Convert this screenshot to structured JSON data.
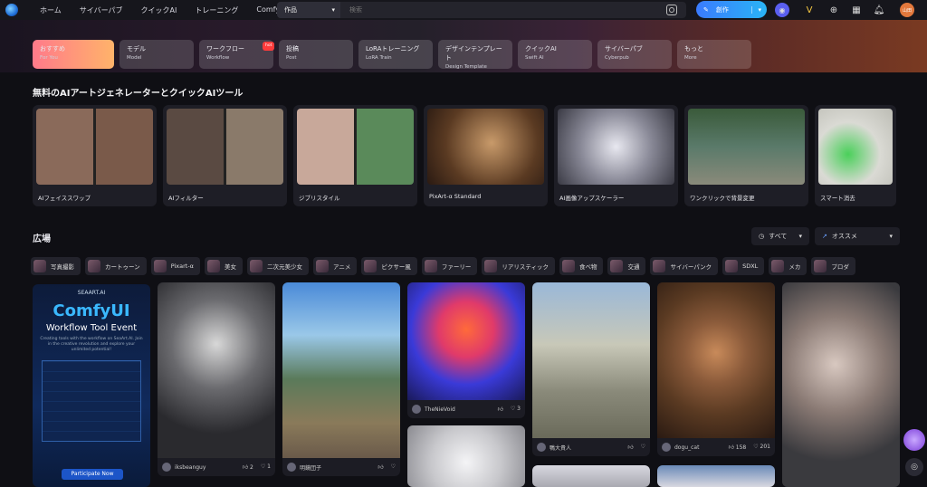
{
  "nav": {
    "items": [
      "ホーム",
      "サイバーパブ",
      "クイックAI",
      "トレーニング",
      "ComfyUI"
    ]
  },
  "search": {
    "scope": "作品",
    "placeholder": "検索"
  },
  "create": {
    "label": "創作"
  },
  "user": {
    "avatar_text": "山田"
  },
  "categories": [
    {
      "ja": "おすすめ",
      "en": "For You"
    },
    {
      "ja": "モデル",
      "en": "Model"
    },
    {
      "ja": "ワークフロー",
      "en": "Workflow",
      "badge": "hot"
    },
    {
      "ja": "投稿",
      "en": "Post"
    },
    {
      "ja": "LoRAトレーニング",
      "en": "LoRA Train"
    },
    {
      "ja": "デザインテンプレート",
      "en": "Design Template"
    },
    {
      "ja": "クイックAI",
      "en": "Swift AI"
    },
    {
      "ja": "サイバーパブ",
      "en": "Cyberpub"
    },
    {
      "ja": "もっと",
      "en": "More"
    }
  ],
  "tools_title": "無料のAIアートジェネレーターとクイックAIツール",
  "tools": [
    "AIフェイススワップ",
    "AIフィルター",
    "ジブリスタイル",
    "PixArt-α Standard",
    "AI画像アップスケーラー",
    "ワンクリックで背景変更",
    "スマート消去"
  ],
  "plaza": {
    "title": "広場",
    "filter_time": "すべて",
    "filter_sort": "オススメ"
  },
  "tags": [
    "写真撮影",
    "カートゥーン",
    "Pixart-α",
    "美女",
    "二次元美少女",
    "アニメ",
    "ピクサー風",
    "ファーリー",
    "リアリスティック",
    "食べ物",
    "交通",
    "サイバーパンク",
    "SDXL",
    "メカ",
    "プロダ"
  ],
  "promo": {
    "brand": "SEAART.AI",
    "title": "ComfyUI",
    "subtitle": "Workflow Tool Event",
    "desc": "Creating tools with the workflow on SeaArt.AI. Join in the creative revolution and explore your unlimited potential!",
    "button": "Participate Now"
  },
  "posts": [
    {
      "user": "iksbeanguy",
      "likes": "2",
      "hearts": "1"
    },
    {
      "user": "明鏡団子",
      "likes": "",
      "hearts": ""
    },
    {
      "user": "TheNieVoid",
      "likes": "",
      "hearts": "3"
    },
    {
      "user": "鴨大貴人",
      "likes": "",
      "hearts": ""
    },
    {
      "user": "dogu_cat",
      "likes": "158",
      "hearts": "201"
    }
  ]
}
